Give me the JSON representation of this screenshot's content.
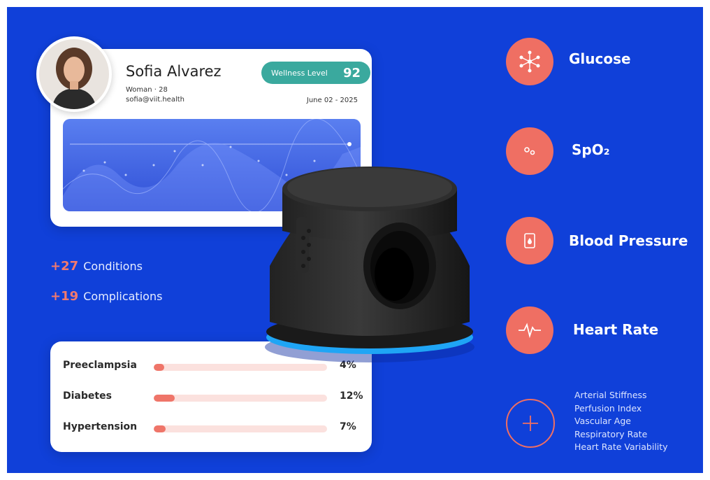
{
  "profile": {
    "name": "Sofia Alvarez",
    "subtitle": "Woman · 28",
    "email": "sofia@viit.health",
    "wellness_label": "Wellness Level",
    "wellness_value": "92",
    "date": "June 02 - 2025"
  },
  "stats": [
    {
      "num": "+27",
      "label": "Conditions"
    },
    {
      "num": "+19",
      "label": "Complications"
    }
  ],
  "risks": [
    {
      "label": "Preeclampsia",
      "pct": "4%",
      "value": 0.04
    },
    {
      "label": "Diabetes",
      "pct": "12%",
      "value": 0.12
    },
    {
      "label": "Hypertension",
      "pct": "7%",
      "value": 0.07
    }
  ],
  "metrics": [
    {
      "label": "Glucose",
      "icon": "molecule-icon"
    },
    {
      "label": "SpO₂",
      "icon": "oxygen-icon"
    },
    {
      "label": "Blood Pressure",
      "icon": "blood-pressure-monitor-icon"
    },
    {
      "label": "Heart Rate",
      "icon": "heartbeat-icon"
    }
  ],
  "extras": [
    "Arterial Stiffness",
    "Perfusion Index",
    "Vascular Age",
    "Respiratory Rate",
    "Heart Rate Variability"
  ],
  "colors": {
    "background": "#1040d9",
    "accent": "#ef6f63",
    "wellness": "#3aa99e"
  }
}
